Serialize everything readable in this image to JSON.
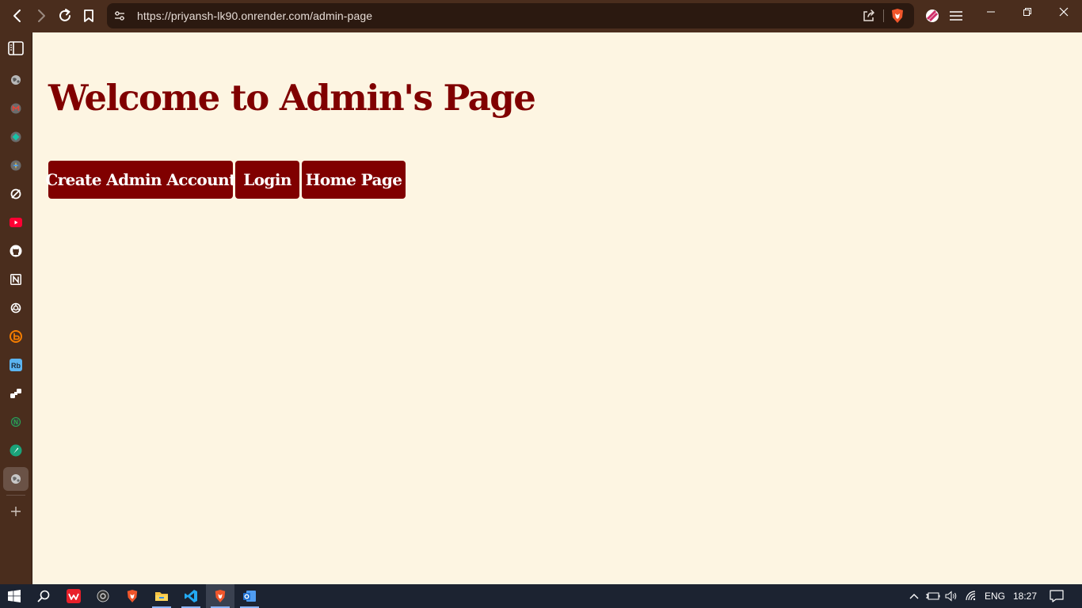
{
  "browser": {
    "url": "https://priyansh-lk90.onrender.com/admin-page",
    "nav_icons": [
      "back-arrow-icon",
      "forward-arrow-icon",
      "reload-icon",
      "bookmark-icon"
    ],
    "url_icons": [
      "site-settings-icon",
      "share-icon",
      "brave-shields-icon"
    ],
    "toolbar_icons": [
      "rewards-icon",
      "menu-icon"
    ],
    "window_controls": [
      "minimize-icon",
      "restore-icon",
      "close-icon"
    ]
  },
  "sidebar": {
    "items": [
      "sidebar-panel-icon",
      "globe-icon",
      "gmail-icon",
      "bookmark-site-icon",
      "compass-site-icon",
      "loop-site-icon",
      "youtube-icon",
      "github-icon",
      "notion-icon",
      "chatgpt-icon",
      "blogger-icon",
      "rb-icon",
      "cubes-icon",
      "node-icon",
      "feather-icon",
      "globe-active-icon",
      "add-icon"
    ]
  },
  "page": {
    "title": "Welcome to Admin's Page",
    "buttons": {
      "create_admin": "Create Admin Account",
      "login": "Login",
      "home": "Home Page"
    }
  },
  "taskbar": {
    "apps": [
      "windows-start-icon",
      "search-icon",
      "wps-office-icon",
      "obs-icon",
      "brave-icon",
      "file-explorer-icon",
      "vscode-icon",
      "brave-active-icon",
      "outlook-icon"
    ],
    "language": "ENG",
    "time": "18:27"
  },
  "colors": {
    "browser_chrome": "#4a2d1d",
    "page_background": "#fdf5e2",
    "accent_maroon": "#800000",
    "taskbar": "#1c2331"
  }
}
